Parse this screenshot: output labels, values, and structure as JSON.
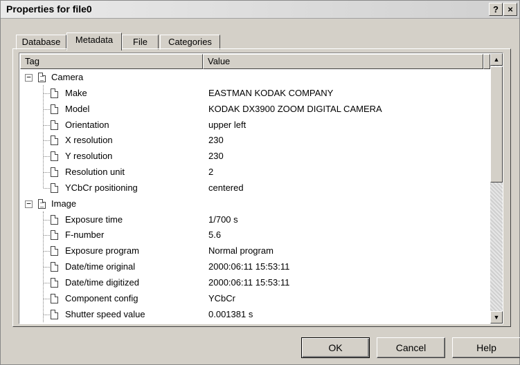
{
  "window": {
    "title": "Properties for file0",
    "help_glyph": "?",
    "close_glyph": "×"
  },
  "tabs": [
    {
      "label": "Database",
      "active": false
    },
    {
      "label": "Metadata",
      "active": true
    },
    {
      "label": "File",
      "active": false
    },
    {
      "label": "Categories",
      "active": false
    }
  ],
  "list": {
    "columns": {
      "tag": "Tag",
      "value": "Value"
    },
    "groups": [
      {
        "name": "Camera",
        "expander": "−",
        "rows": [
          {
            "tag": "Make",
            "value": "EASTMAN KODAK COMPANY"
          },
          {
            "tag": "Model",
            "value": "KODAK DX3900 ZOOM DIGITAL CAMERA"
          },
          {
            "tag": "Orientation",
            "value": "upper left"
          },
          {
            "tag": "X resolution",
            "value": "230"
          },
          {
            "tag": "Y resolution",
            "value": "230"
          },
          {
            "tag": "Resolution unit",
            "value": "2"
          },
          {
            "tag": "YCbCr positioning",
            "value": "centered"
          }
        ]
      },
      {
        "name": "Image",
        "expander": "−",
        "rows": [
          {
            "tag": "Exposure time",
            "value": "1/700 s"
          },
          {
            "tag": "F-number",
            "value": "5.6"
          },
          {
            "tag": "Exposure program",
            "value": "Normal program"
          },
          {
            "tag": "Date/time original",
            "value": "2000:06:11 15:53:11"
          },
          {
            "tag": "Date/time digitized",
            "value": "2000:06:11 15:53:11"
          },
          {
            "tag": "Component config",
            "value": "YCbCr"
          },
          {
            "tag": "Shutter speed value",
            "value": "0.001381 s"
          }
        ]
      }
    ],
    "scroll_up_glyph": "▲",
    "scroll_down_glyph": "▼"
  },
  "buttons": {
    "ok": "OK",
    "cancel": "Cancel",
    "help": "Help"
  }
}
